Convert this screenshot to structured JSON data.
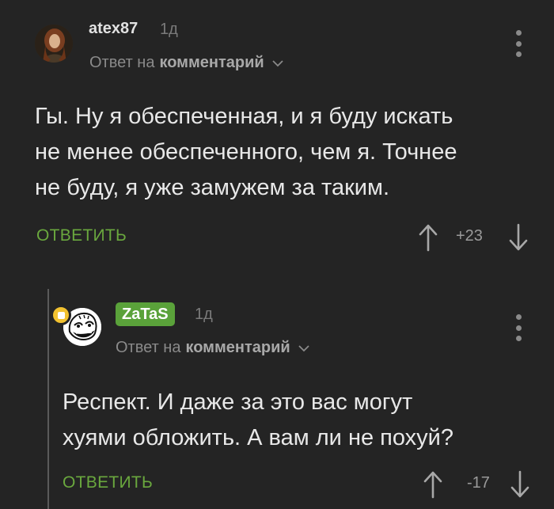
{
  "comments": [
    {
      "username": "atex87",
      "time": "1д",
      "reply_prefix": "Ответ на",
      "reply_target": "комментарий",
      "body_lines": [
        "Гы. Ну я обеспеченная, и я буду искать",
        "не менее обеспеченного, чем я. Точнее",
        "не буду, я уже замужем за таким."
      ],
      "reply_label": "ОТВЕТИТЬ",
      "score": "+23"
    },
    {
      "username": "ZaTaS",
      "time": "1д",
      "reply_prefix": "Ответ на",
      "reply_target": "комментарий",
      "body_lines": [
        "Респект. И даже за это вас могут",
        "хуями обложить. А вам ли не похуй?"
      ],
      "reply_label": "ОТВЕТИТЬ",
      "score": "-17"
    }
  ],
  "icons": {
    "upvote": "arrow-up-icon",
    "downvote": "arrow-down-icon",
    "menu": "more-vertical-icon",
    "expand": "chevron-down-icon",
    "badge": "document-badge-icon"
  },
  "colors": {
    "background": "#242424",
    "accent_green": "#6aa83e",
    "username_badge": "#5aa23a",
    "badge_yellow": "#f2c230"
  }
}
